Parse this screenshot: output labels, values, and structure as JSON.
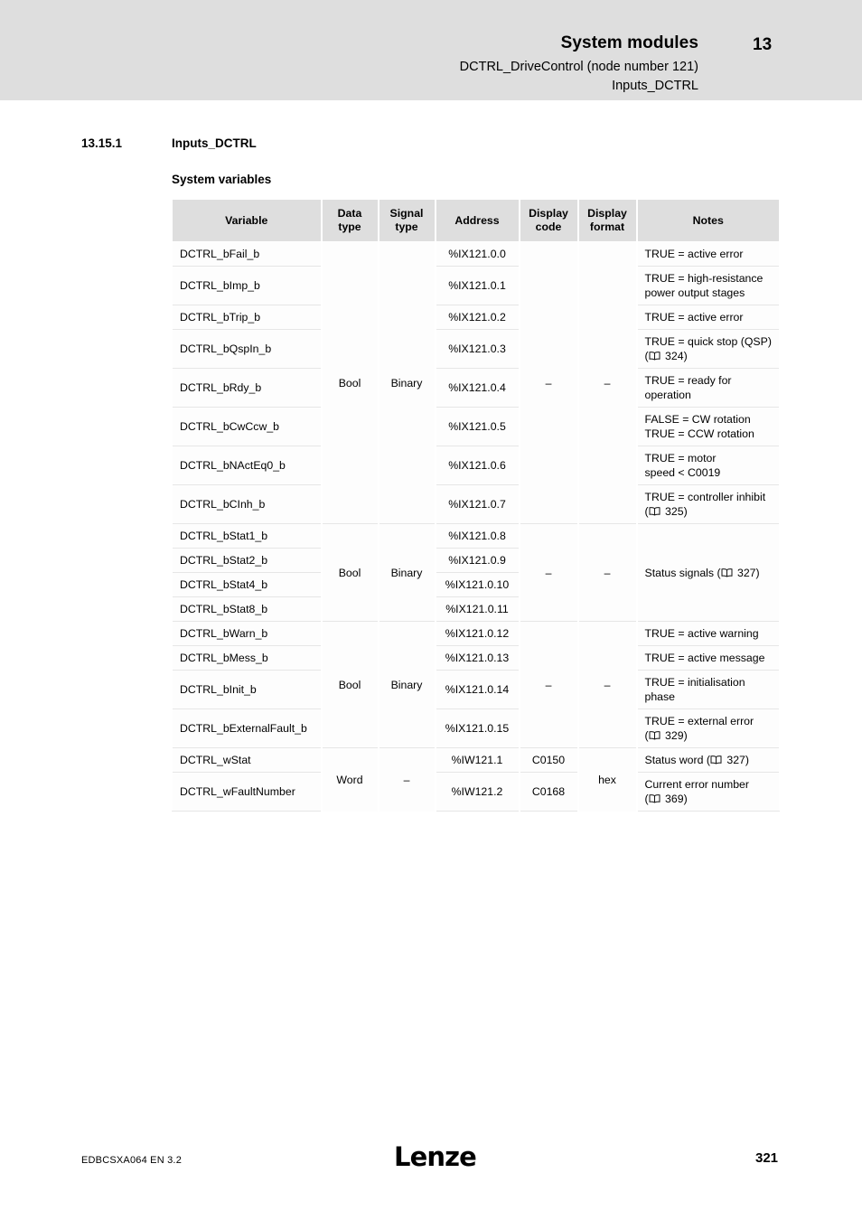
{
  "header": {
    "title": "System modules",
    "subtitle1": "DCTRL_DriveControl (node number 121)",
    "subtitle2": "Inputs_DCTRL",
    "chapter": "13"
  },
  "section": {
    "number": "13.15.1",
    "title": "Inputs_DCTRL",
    "subtitle": "System variables"
  },
  "table": {
    "columns": [
      "Variable",
      "Data\ntype",
      "Signal\ntype",
      "Address",
      "Display\ncode",
      "Display\nformat",
      "Notes"
    ],
    "columns_flat": {
      "variable": "Variable",
      "data_type_l1": "Data",
      "data_type_l2": "type",
      "signal_type_l1": "Signal",
      "signal_type_l2": "type",
      "address": "Address",
      "display_code_l1": "Display",
      "display_code_l2": "code",
      "display_format_l1": "Display",
      "display_format_l2": "format",
      "notes": "Notes"
    },
    "groups": [
      {
        "data_type": "Bool",
        "signal_type": "Binary",
        "display_code": "–",
        "display_format": "–",
        "rows": [
          {
            "variable": "DCTRL_bFail_b",
            "address": "%IX121.0.0",
            "notes_line1": "TRUE = active error",
            "notes_line2": "",
            "ref_page": ""
          },
          {
            "variable": "DCTRL_bImp_b",
            "address": "%IX121.0.1",
            "notes_line1": "TRUE = high-resistance",
            "notes_line2": "power output stages",
            "ref_page": ""
          },
          {
            "variable": "DCTRL_bTrip_b",
            "address": "%IX121.0.2",
            "notes_line1": "TRUE = active error",
            "notes_line2": "",
            "ref_page": ""
          },
          {
            "variable": "DCTRL_bQspIn_b",
            "address": "%IX121.0.3",
            "notes_line1": "TRUE = quick stop (QSP)",
            "notes_line2": "",
            "ref_page": "324"
          },
          {
            "variable": "DCTRL_bRdy_b",
            "address": "%IX121.0.4",
            "notes_line1": "TRUE = ready for",
            "notes_line2": "operation",
            "ref_page": ""
          },
          {
            "variable": "DCTRL_bCwCcw_b",
            "address": "%IX121.0.5",
            "notes_line1": "FALSE = CW rotation",
            "notes_line2": "TRUE = CCW rotation",
            "ref_page": ""
          },
          {
            "variable": "DCTRL_bNActEq0_b",
            "address": "%IX121.0.6",
            "notes_line1": "TRUE = motor",
            "notes_line2": "speed < C0019",
            "ref_page": ""
          },
          {
            "variable": "DCTRL_bCInh_b",
            "address": "%IX121.0.7",
            "notes_line1": "TRUE = controller inhibit",
            "notes_line2": "",
            "ref_page": "325"
          }
        ]
      },
      {
        "data_type": "Bool",
        "signal_type": "Binary",
        "display_code": "–",
        "display_format": "–",
        "merged_note": "Status signals",
        "merged_note_ref": "327",
        "rows": [
          {
            "variable": "DCTRL_bStat1_b",
            "address": "%IX121.0.8"
          },
          {
            "variable": "DCTRL_bStat2_b",
            "address": "%IX121.0.9"
          },
          {
            "variable": "DCTRL_bStat4_b",
            "address": "%IX121.0.10"
          },
          {
            "variable": "DCTRL_bStat8_b",
            "address": "%IX121.0.11"
          }
        ]
      },
      {
        "data_type": "Bool",
        "signal_type": "Binary",
        "display_code": "–",
        "display_format": "–",
        "rows": [
          {
            "variable": "DCTRL_bWarn_b",
            "address": "%IX121.0.12",
            "notes_line1": "TRUE = active warning",
            "notes_line2": "",
            "ref_page": ""
          },
          {
            "variable": "DCTRL_bMess_b",
            "address": "%IX121.0.13",
            "notes_line1": "TRUE = active message",
            "notes_line2": "",
            "ref_page": ""
          },
          {
            "variable": "DCTRL_bInit_b",
            "address": "%IX121.0.14",
            "notes_line1": "TRUE = initialisation",
            "notes_line2": "phase",
            "ref_page": ""
          },
          {
            "variable": "DCTRL_bExternalFault_b",
            "address": "%IX121.0.15",
            "notes_line1": "TRUE = external error",
            "notes_line2": "",
            "ref_page": "329"
          }
        ]
      },
      {
        "data_type": "Word",
        "signal_type": "–",
        "display_format": "hex",
        "rows": [
          {
            "variable": "DCTRL_wStat",
            "address": "%IW121.1",
            "display_code": "C0150",
            "notes_line1": "Status word",
            "notes_line2": "",
            "ref_page": "327",
            "ref_inline": true
          },
          {
            "variable": "DCTRL_wFaultNumber",
            "address": "%IW121.2",
            "display_code": "C0168",
            "notes_line1": "Current error number",
            "notes_line2": "",
            "ref_page": "369",
            "ref_inline": false
          }
        ]
      }
    ]
  },
  "footer": {
    "document_id": "EDBCSXA064  EN  3.2",
    "logo": "Lenze",
    "page_number": "321"
  },
  "colors": {
    "header_band": "#dedede",
    "table_header": "#dedede",
    "rule": "#e6e6e6",
    "text": "#000000"
  }
}
